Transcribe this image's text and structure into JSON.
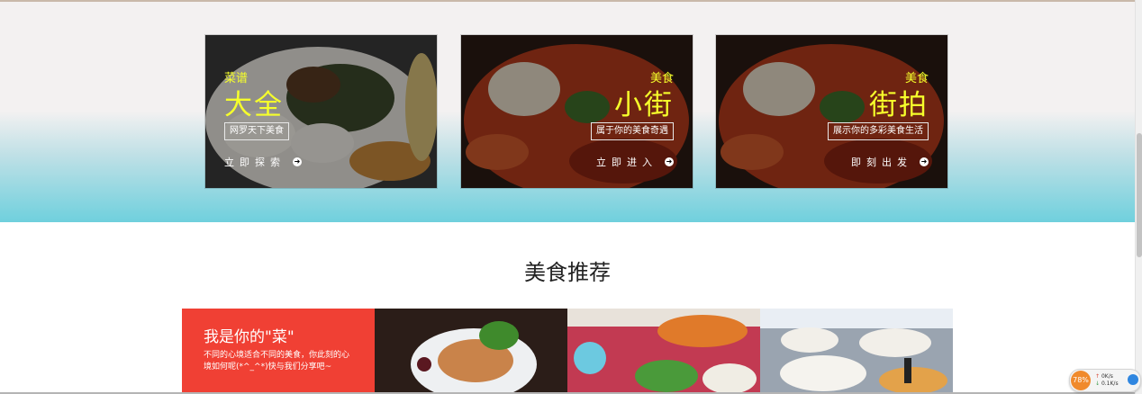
{
  "cards": [
    {
      "small": "菜谱",
      "big": "大全",
      "tag": "网罗天下美食",
      "action": "立即探索"
    },
    {
      "small": "美食",
      "big": "小街",
      "tag": "属于你的美食奇遇",
      "action": "立即进入"
    },
    {
      "small": "美食",
      "big": "街拍",
      "tag": "展示你的多彩美食生活",
      "action": "即刻出发"
    }
  ],
  "section": {
    "title": "美食推荐"
  },
  "recommend": {
    "title": "我是你的\"菜\"",
    "desc": "不同的心境适合不同的美食，你此刻的心境如何呢(*^_^*)快与我们分享吧~"
  },
  "net_widget": {
    "percent": "78%",
    "up": "0K/s",
    "down": "0.1K/s"
  },
  "colors": {
    "accent_yellow": "#f6ff2b",
    "teal": "#6fd0dd",
    "red": "#f04034"
  }
}
